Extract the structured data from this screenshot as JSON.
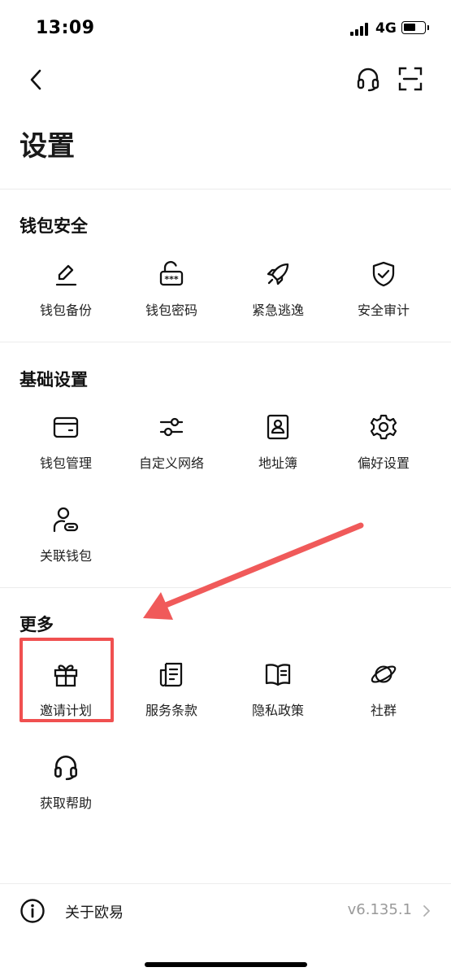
{
  "status_bar": {
    "time": "13:09",
    "network": "4G"
  },
  "header": {
    "title": "设置"
  },
  "sections": [
    {
      "title": "钱包安全",
      "items": [
        {
          "label": "钱包备份",
          "icon": "pen-icon"
        },
        {
          "label": "钱包密码",
          "icon": "unlock-password-icon"
        },
        {
          "label": "紧急逃逸",
          "icon": "rocket-icon"
        },
        {
          "label": "安全审计",
          "icon": "shield-check-icon"
        }
      ]
    },
    {
      "title": "基础设置",
      "items": [
        {
          "label": "钱包管理",
          "icon": "wallet-icon"
        },
        {
          "label": "自定义网络",
          "icon": "sliders-icon"
        },
        {
          "label": "地址簿",
          "icon": "contact-book-icon"
        },
        {
          "label": "偏好设置",
          "icon": "gear-icon"
        },
        {
          "label": "关联钱包",
          "icon": "user-link-icon"
        }
      ]
    },
    {
      "title": "更多",
      "items": [
        {
          "label": "邀请计划",
          "icon": "gift-icon"
        },
        {
          "label": "服务条款",
          "icon": "terms-document-icon"
        },
        {
          "label": "隐私政策",
          "icon": "open-book-icon"
        },
        {
          "label": "社群",
          "icon": "planet-icon"
        },
        {
          "label": "获取帮助",
          "icon": "headset-icon"
        }
      ]
    }
  ],
  "about": {
    "label": "关于欧易",
    "version": "v6.135.1"
  },
  "colors": {
    "highlight": "#f05050",
    "text": "#1a1a1a",
    "muted": "#9a9a9a",
    "divider": "#ececec"
  }
}
